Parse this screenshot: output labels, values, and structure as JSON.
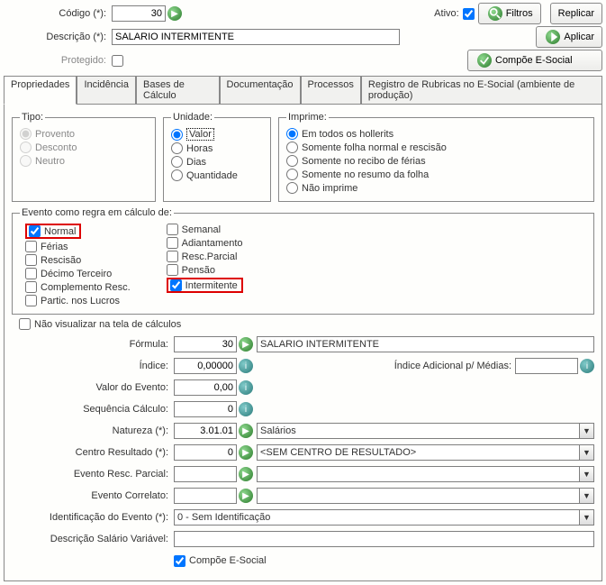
{
  "header": {
    "codigo_label": "Código (*):",
    "codigo_value": "30",
    "ativo_label": "Ativo:",
    "ativo_checked": true,
    "filtros_label": "Filtros",
    "replicar_label": "Replicar",
    "desc_label": "Descrição (*):",
    "desc_value": "SALARIO INTERMITENTE",
    "aplicar_label": "Aplicar",
    "protegido_label": "Protegido:",
    "compoe_label": "Compõe E-Social"
  },
  "tabs": {
    "items": [
      {
        "label": "Propriedades",
        "active": true
      },
      {
        "label": "Incidência"
      },
      {
        "label": "Bases de Cálculo"
      },
      {
        "label": "Documentação"
      },
      {
        "label": "Processos"
      },
      {
        "label": "Registro de Rubricas no E-Social (ambiente de produção)"
      }
    ]
  },
  "groups": {
    "tipo": {
      "legend": "Tipo:",
      "items": [
        {
          "label": "Provento",
          "checked": true
        },
        {
          "label": "Desconto",
          "checked": false
        },
        {
          "label": "Neutro",
          "checked": false
        }
      ]
    },
    "unidade": {
      "legend": "Unidade:",
      "items": [
        {
          "label": "Valor",
          "checked": true,
          "highlight": true
        },
        {
          "label": "Horas",
          "checked": false
        },
        {
          "label": "Dias",
          "checked": false
        },
        {
          "label": "Quantidade",
          "checked": false
        }
      ]
    },
    "imprime": {
      "legend": "Imprime:",
      "items": [
        {
          "label": "Em todos os hollerits",
          "checked": true
        },
        {
          "label": "Somente folha normal e rescisão",
          "checked": false
        },
        {
          "label": "Somente no recibo de férias",
          "checked": false
        },
        {
          "label": "Somente no resumo da folha",
          "checked": false
        },
        {
          "label": "Não imprime",
          "checked": false
        }
      ]
    },
    "evento_regra": {
      "legend": "Evento como regra em cálculo de:",
      "col1": [
        {
          "label": "Normal",
          "checked": true,
          "red": true
        },
        {
          "label": "Férias",
          "checked": false
        },
        {
          "label": "Rescisão",
          "checked": false
        },
        {
          "label": "Décimo Terceiro",
          "checked": false
        },
        {
          "label": "Complemento Resc.",
          "checked": false
        },
        {
          "label": "Partic. nos Lucros",
          "checked": false
        }
      ],
      "col2": [
        {
          "label": "Semanal",
          "checked": false
        },
        {
          "label": "Adiantamento",
          "checked": false
        },
        {
          "label": "Resc.Parcial",
          "checked": false
        },
        {
          "label": "Pensão",
          "checked": false
        },
        {
          "label": "Intermitente",
          "checked": true,
          "red": true
        }
      ]
    }
  },
  "nao_visualizar_label": "Não visualizar na tela de cálculos",
  "fields": {
    "formula": {
      "label": "Fórmula:",
      "value": "30",
      "combo": "SALARIO INTERMITENTE"
    },
    "indice": {
      "label": "Índice:",
      "value": "0,00000",
      "extra_label": "Índice Adicional p/ Médias:",
      "extra_value": ""
    },
    "valor_evento": {
      "label": "Valor do Evento:",
      "value": "0,00"
    },
    "seq_calc": {
      "label": "Sequência Cálculo:",
      "value": "0"
    },
    "natureza": {
      "label": "Natureza (*):",
      "value": "3.01.01",
      "combo": "Salários"
    },
    "centro": {
      "label": "Centro Resultado (*):",
      "value": "0",
      "combo": "<SEM CENTRO DE RESULTADO>"
    },
    "evento_resc": {
      "label": "Evento Resc. Parcial:",
      "value": "",
      "combo": ""
    },
    "evento_correlato": {
      "label": "Evento Correlato:",
      "value": "",
      "combo": ""
    },
    "identificacao": {
      "label": "Identificação do Evento (*):",
      "combo": "0 - Sem Identificação"
    },
    "desc_salario": {
      "label": "Descrição Salário Variável:",
      "value": ""
    },
    "compoe_label": "Compõe E-Social",
    "compoe_checked": true
  }
}
